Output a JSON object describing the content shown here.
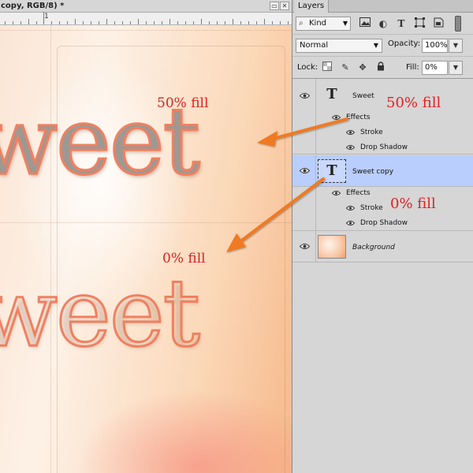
{
  "document": {
    "tab_title": "copy, RGB/8) *",
    "ruler_label": "1",
    "canvas_words": {
      "top": "weet",
      "bottom": "weet"
    }
  },
  "annotations": {
    "canvas_50": "50% fill",
    "canvas_0": "0% fill",
    "panel_50": "50% fill",
    "panel_0": "0% fill"
  },
  "panel": {
    "tab_label": "Layers",
    "kind_filter": "Kind",
    "blend_mode": "Normal",
    "opacity_label": "Opacity:",
    "opacity_value": "100%",
    "lock_label": "Lock:",
    "fill_label": "Fill:",
    "fill_value": "0%"
  },
  "layers": [
    {
      "name": "Sweet",
      "thumb": "T",
      "selected": false,
      "effects_label": "Effects",
      "effects": [
        "Stroke",
        "Drop Shadow"
      ]
    },
    {
      "name": "Sweet copy",
      "thumb": "T",
      "selected": true,
      "effects_label": "Effects",
      "effects": [
        "Stroke",
        "Drop Shadow"
      ]
    },
    {
      "name": "Background",
      "thumb": "image",
      "selected": false
    }
  ],
  "colors": {
    "annotation": "#e02020",
    "arrow": "#f07a20",
    "stroke": "#f08060",
    "selection": "#b9cefc"
  }
}
